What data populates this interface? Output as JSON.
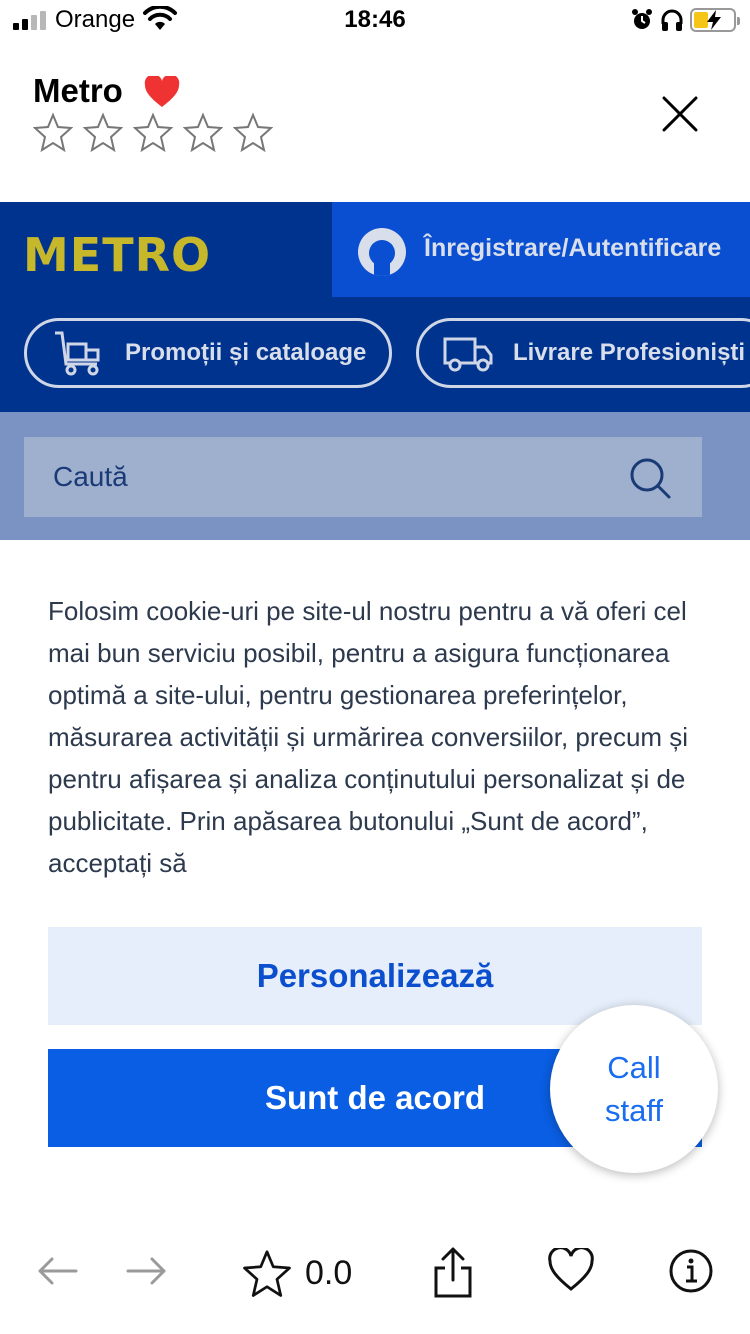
{
  "status_bar": {
    "carrier": "Orange",
    "time": "18:46",
    "battery_color": "#f5c518"
  },
  "app_header": {
    "title": "Metro",
    "heart_icon": "heart-icon",
    "rating_stars": 0,
    "rating_max": 5,
    "close_icon": "close-icon"
  },
  "metro": {
    "logo": "METRO",
    "login_label": "Înregistrare/Autentificare",
    "nav_pills": [
      {
        "label": "Promoții și cataloage",
        "icon": "cart-icon"
      },
      {
        "label": "Livrare Profesioniști",
        "icon": "truck-icon"
      }
    ],
    "search_placeholder": "Caută",
    "colors": {
      "header_bg": "#00338d",
      "logo": "#c7b72b",
      "login_bg": "#0a4fd2",
      "search_band": "#7a93c2"
    }
  },
  "cookie": {
    "text": "Folosim cookie-uri pe site-ul nostru pentru a vă oferi cel mai bun serviciu posibil, pentru a asigura funcționarea optimă a site-ului, pentru gestionarea preferințelor, măsurarea activității și urmărirea conversiilor, precum și pentru afișarea și analiza conținutului personalizat și de publicitate. Prin apăsarea butonului „Sunt de acord”, acceptați să",
    "personalize_label": "Personalizează",
    "accept_label": "Sunt de acord",
    "accent": "#0a5ee3"
  },
  "call_staff": {
    "label": "Call staff"
  },
  "toolbar": {
    "rating": "0.0",
    "items": [
      "back-arrow-icon",
      "forward-arrow-icon",
      "star-icon",
      "share-icon",
      "heart-outline-icon",
      "info-icon"
    ]
  }
}
